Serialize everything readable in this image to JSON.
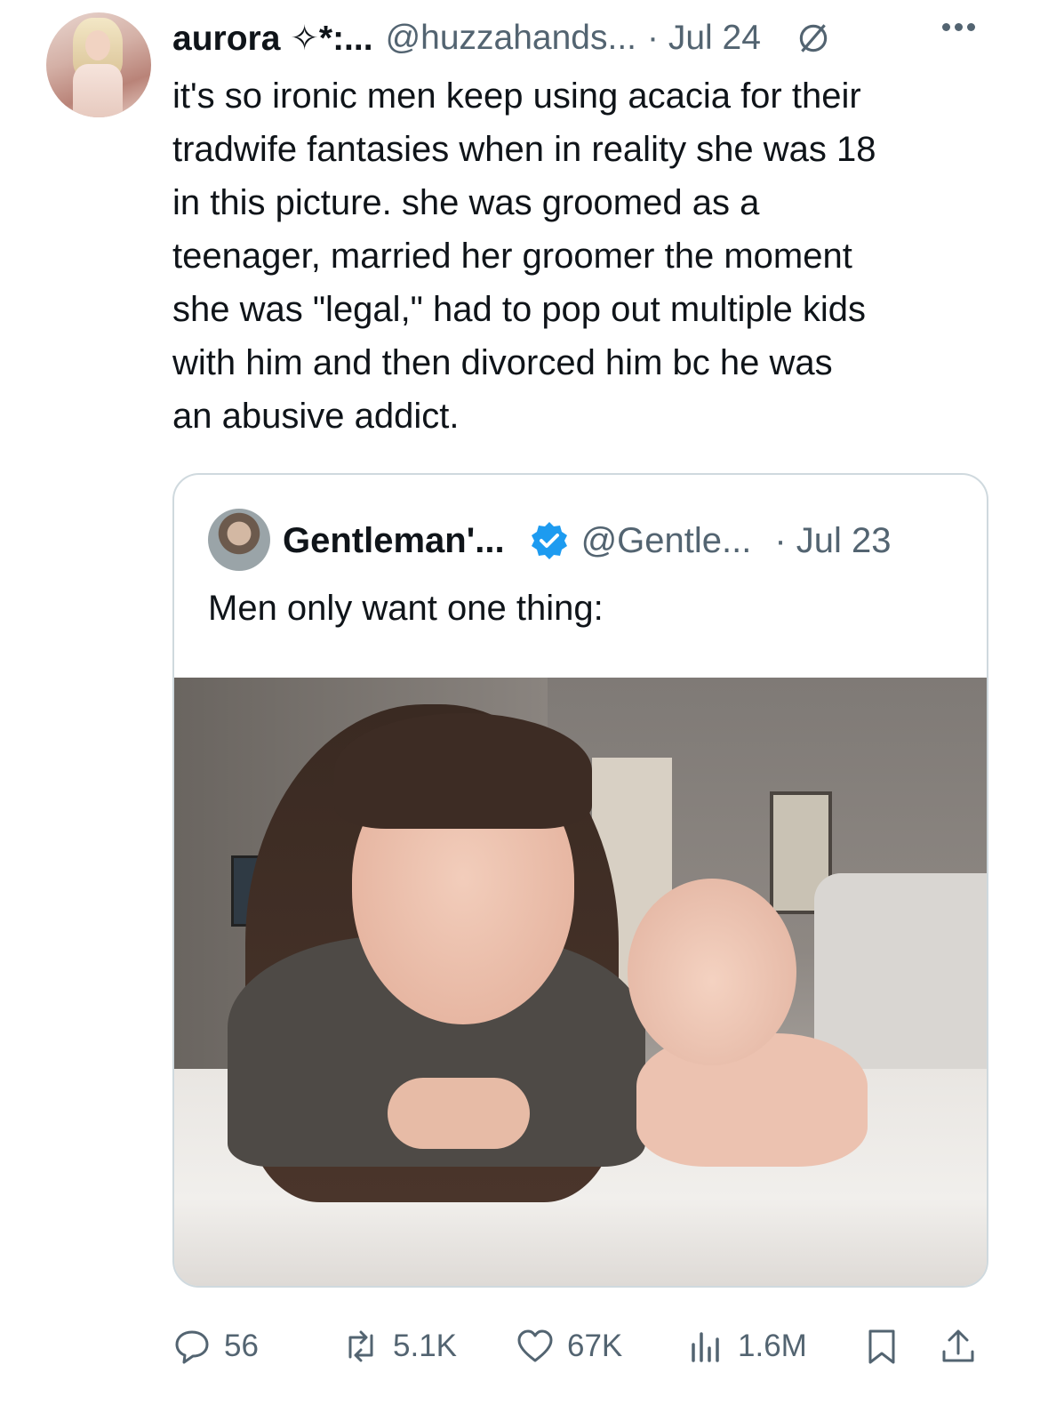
{
  "tweet": {
    "display_name": "aurora ✧*:...",
    "handle": "@huzzahands...",
    "date": "· Jul 24",
    "text": "it's so ironic men keep using acacia for their\ntradwife fantasies when in reality she was 18\nin this picture. she was groomed as a\nteenager, married her groomer the moment\nshe was \"legal,\" had to pop out multiple kids\nwith him and then divorced him bc he was\nan abusive addict."
  },
  "quoted": {
    "display_name": "Gentleman'...",
    "handle": "@Gentle...",
    "date": "· Jul 23",
    "text": "Men only want one thing:"
  },
  "actions": {
    "replies": "56",
    "reposts": "5.1K",
    "likes": "67K",
    "views": "1.6M"
  },
  "icons": [
    "reply-icon",
    "repost-icon",
    "like-icon",
    "views-icon",
    "bookmark-icon",
    "share-icon",
    "verified-badge-icon",
    "more-icon"
  ],
  "colors": {
    "verified": "#1d9bf0",
    "muted": "#536471",
    "text": "#0f1419",
    "border": "#cfd9de"
  }
}
